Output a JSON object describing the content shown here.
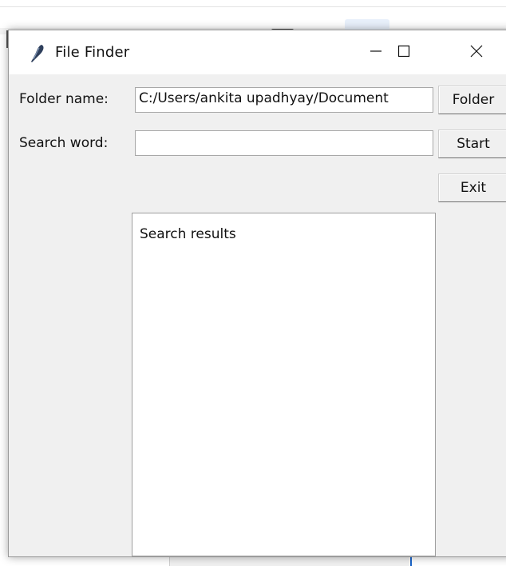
{
  "window": {
    "title": "File Finder",
    "icon": "feather-icon",
    "controls": [
      "minimize-icon",
      "maximize-icon",
      "close-icon"
    ]
  },
  "form": {
    "folder_label": "Folder name:",
    "folder_value": "C:/Users/ankita upadhyay/Document",
    "folder_button": "Folder",
    "search_label": "Search word:",
    "search_value": "",
    "start_button": "Start",
    "exit_button": "Exit"
  },
  "results": {
    "text": "Search results"
  }
}
